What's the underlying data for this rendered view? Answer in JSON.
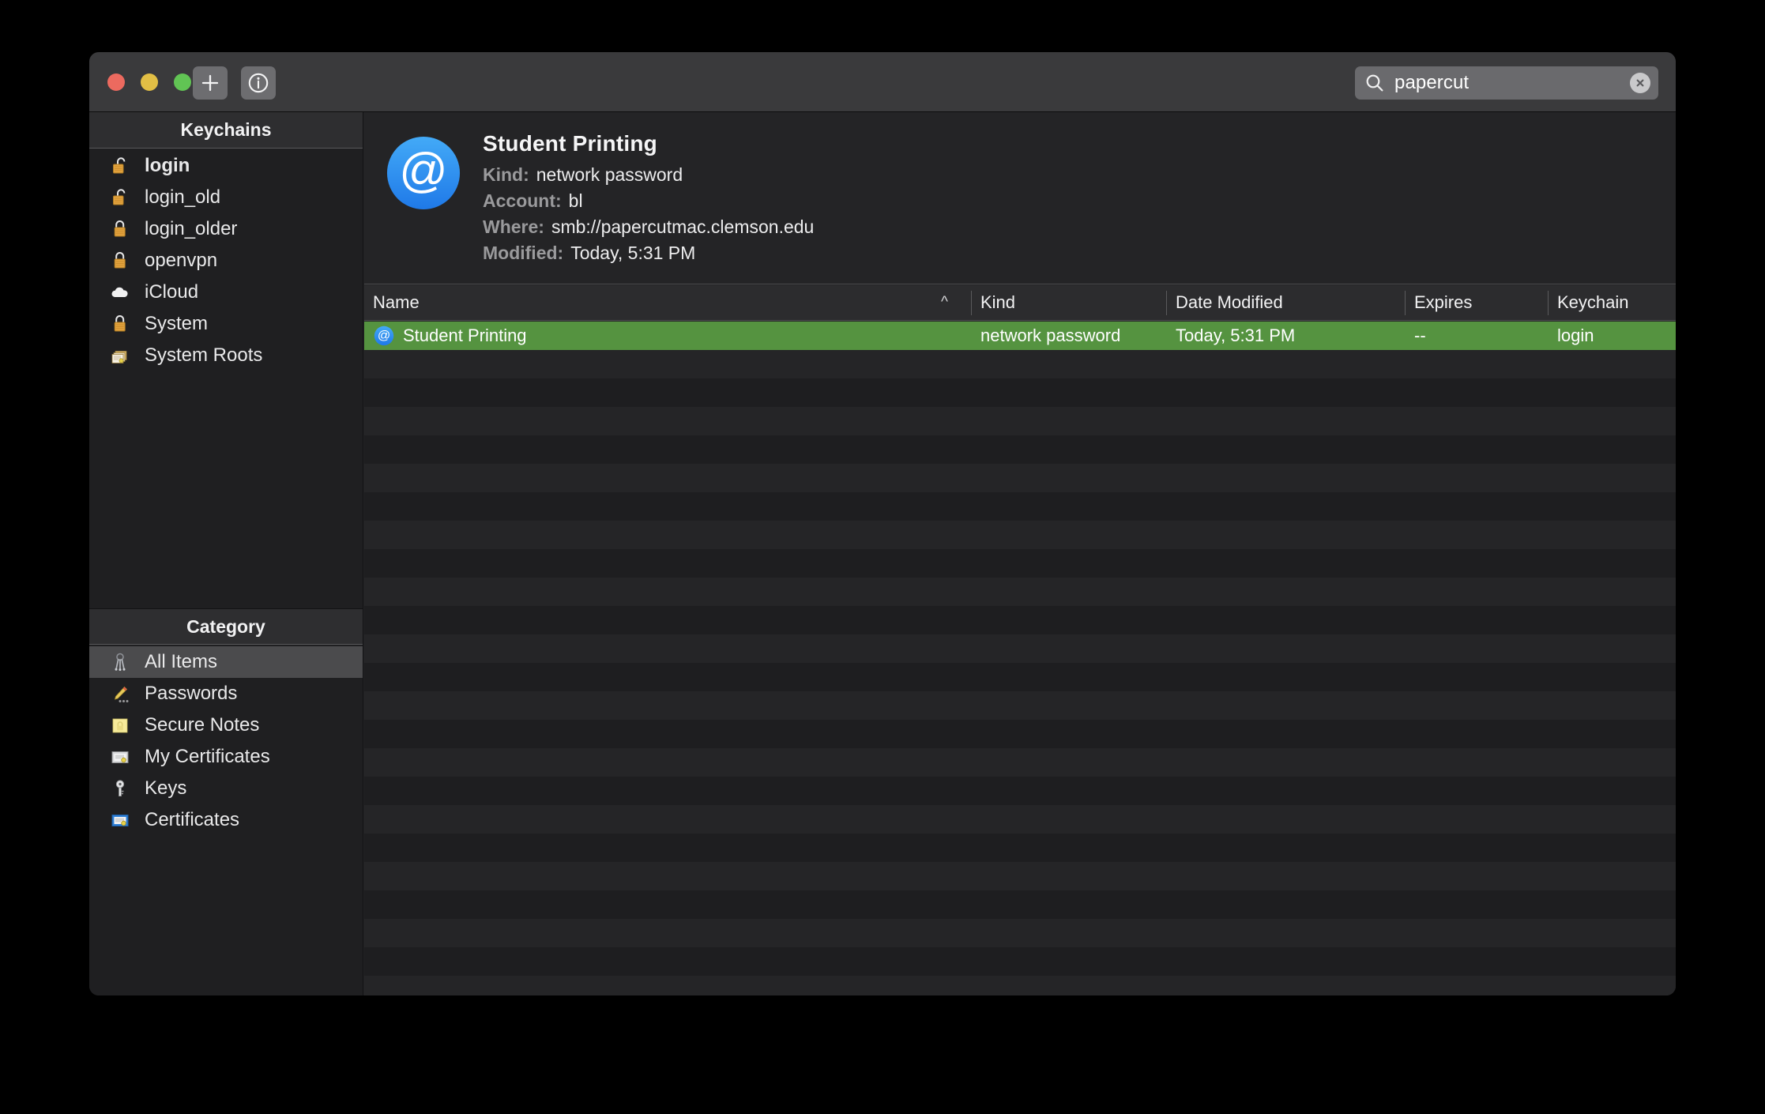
{
  "window": {
    "traffic_lights": [
      "close",
      "minimize",
      "zoom"
    ],
    "toolbar": {
      "add_label": "+",
      "info_label": "i"
    },
    "search": {
      "value": "papercut",
      "placeholder": "Search"
    }
  },
  "sidebar": {
    "keychains_header": "Keychains",
    "keychains": [
      {
        "label": "login",
        "icon": "unlocked-keychain-icon",
        "bold": true
      },
      {
        "label": "login_old",
        "icon": "unlocked-keychain-icon",
        "bold": false
      },
      {
        "label": "login_older",
        "icon": "locked-keychain-icon",
        "bold": false
      },
      {
        "label": "openvpn",
        "icon": "locked-keychain-icon",
        "bold": false
      },
      {
        "label": "iCloud",
        "icon": "cloud-icon",
        "bold": false
      },
      {
        "label": "System",
        "icon": "locked-keychain-icon",
        "bold": false
      },
      {
        "label": "System Roots",
        "icon": "certificates-stack-icon",
        "bold": false
      }
    ],
    "category_header": "Category",
    "categories": [
      {
        "label": "All Items",
        "icon": "keyring-icon",
        "selected": true
      },
      {
        "label": "Passwords",
        "icon": "pencil-icon",
        "selected": false
      },
      {
        "label": "Secure Notes",
        "icon": "secure-note-icon",
        "selected": false
      },
      {
        "label": "My Certificates",
        "icon": "certificate-icon",
        "selected": false
      },
      {
        "label": "Keys",
        "icon": "key-icon",
        "selected": false
      },
      {
        "label": "Certificates",
        "icon": "certificate-blue-icon",
        "selected": false
      }
    ]
  },
  "detail": {
    "icon": "at-sign-network-password-icon",
    "title": "Student Printing",
    "fields": [
      {
        "label": "Kind:",
        "value": "network password"
      },
      {
        "label": "Account:",
        "value": "bl"
      },
      {
        "label": "Where:",
        "value": "smb://papercutmac.clemson.edu"
      },
      {
        "label": "Modified:",
        "value": "Today, 5:31 PM"
      }
    ]
  },
  "table": {
    "columns": [
      {
        "key": "name",
        "label": "Name",
        "sorted": true,
        "sort_direction": "ascending"
      },
      {
        "key": "kind",
        "label": "Kind"
      },
      {
        "key": "modified",
        "label": "Date Modified"
      },
      {
        "key": "expires",
        "label": "Expires"
      },
      {
        "key": "keychain",
        "label": "Keychain"
      }
    ],
    "rows": [
      {
        "selected": true,
        "icon": "at-sign-network-password-icon",
        "name": "Student Printing",
        "kind": "network password",
        "modified": "Today, 5:31 PM",
        "expires": "--",
        "keychain": "login"
      }
    ],
    "empty_row_count": 24
  },
  "colors": {
    "selection_green": "#559340",
    "window_chrome": "#3a3a3c",
    "sidebar_bg": "#1f1f21",
    "content_bg": "#242426",
    "accent_blue": "#2f97f5"
  }
}
